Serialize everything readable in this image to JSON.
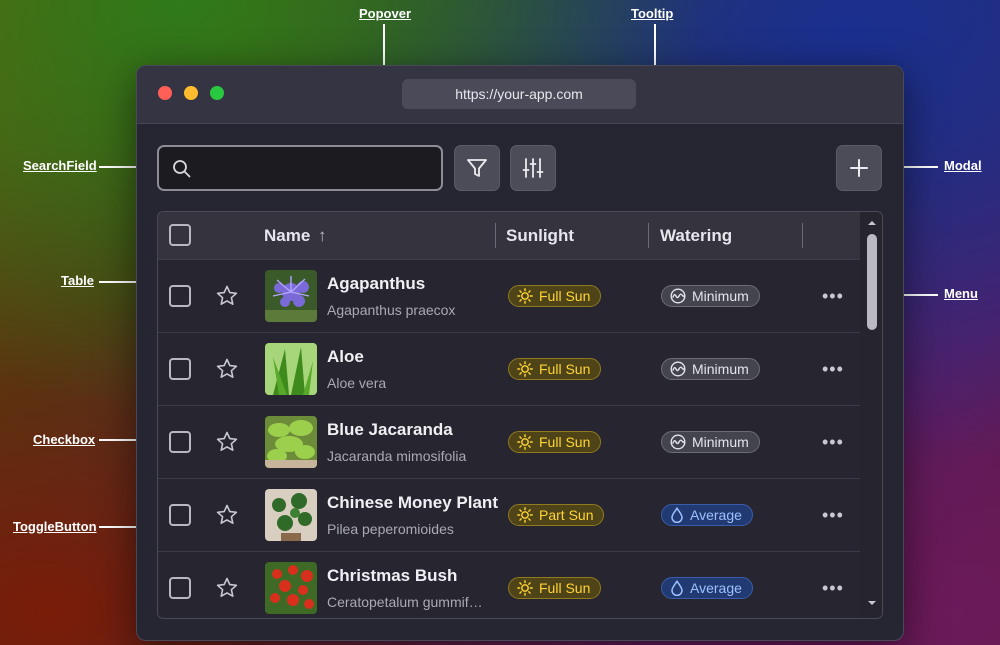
{
  "callouts": {
    "popover": "Popover",
    "tooltip": "Tooltip",
    "searchfield": "SearchField",
    "modal": "Modal",
    "table": "Table",
    "menu": "Menu",
    "checkbox": "Checkbox",
    "togglebutton": "ToggleButton"
  },
  "window": {
    "url": "https://your-app.com",
    "traffic_lights": {
      "close": "#ff5f57",
      "minimize": "#febc2e",
      "maximize": "#28c840"
    }
  },
  "toolbar": {
    "search_placeholder": "",
    "filter_icon": "filter-icon",
    "settings_icon": "sliders-icon",
    "add_icon": "plus-icon"
  },
  "table": {
    "columns": {
      "name": "Name",
      "sunlight": "Sunlight",
      "watering": "Watering"
    },
    "sort_indicator": "↑",
    "rows": [
      {
        "name": "Agapanthus",
        "scientific": "Agapanthus praecox",
        "sunlight": "Full Sun",
        "watering": "Minimum",
        "watering_kind": "min"
      },
      {
        "name": "Aloe",
        "scientific": "Aloe vera",
        "sunlight": "Full Sun",
        "watering": "Minimum",
        "watering_kind": "min"
      },
      {
        "name": "Blue Jacaranda",
        "scientific": "Jacaranda mimosifolia",
        "sunlight": "Full Sun",
        "watering": "Minimum",
        "watering_kind": "min"
      },
      {
        "name": "Chinese Money Plant",
        "scientific": "Pilea peperomioides",
        "sunlight": "Part Sun",
        "watering": "Average",
        "watering_kind": "avg"
      },
      {
        "name": "Christmas Bush",
        "scientific": "Ceratopetalum gummif…",
        "sunlight": "Full Sun",
        "watering": "Average",
        "watering_kind": "avg"
      }
    ],
    "more_label": "•••"
  },
  "colors": {
    "sun_text": "#ffd534",
    "water_avg_text": "#9cc0ff"
  }
}
